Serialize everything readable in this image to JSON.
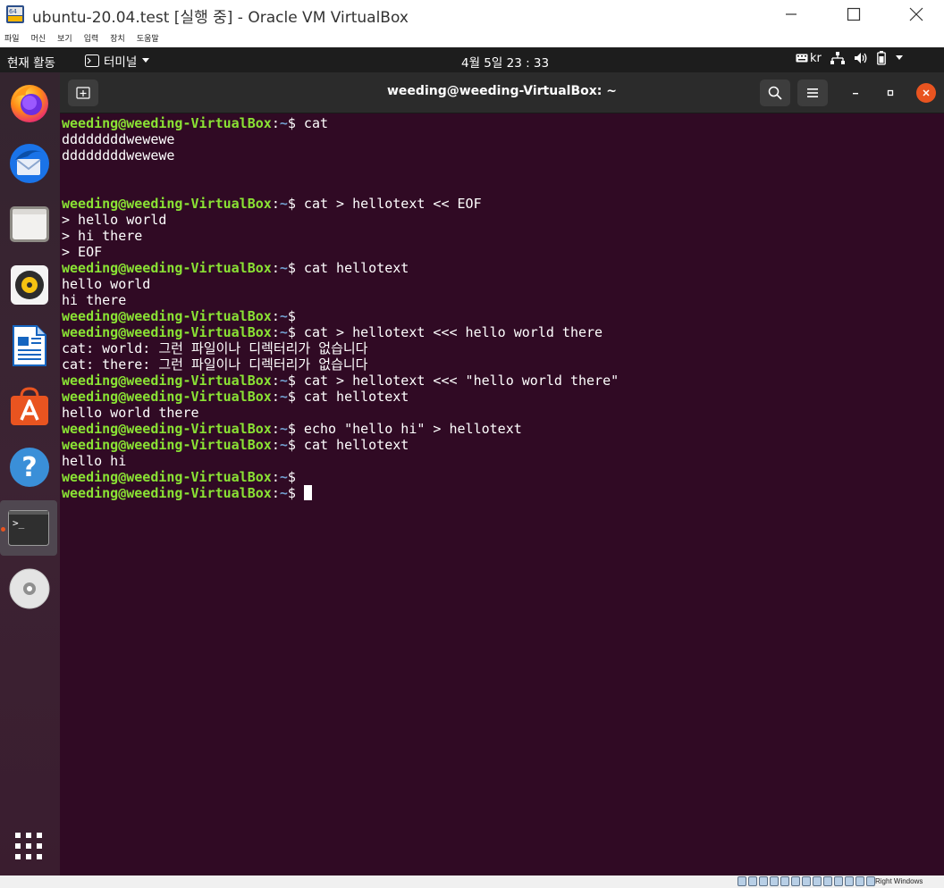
{
  "vbox": {
    "title": "ubuntu-20.04.test [실행 중] - Oracle VM VirtualBox",
    "menu": [
      "파일",
      "머신",
      "보기",
      "입력",
      "장치",
      "도움말"
    ],
    "host_key": "Right Windows"
  },
  "topbar": {
    "activities": "현재 활동",
    "app_menu": "터미널",
    "clock": "4월 5일  23 : 33",
    "keyboard": "kr"
  },
  "dock": {
    "items": [
      "firefox-icon",
      "thunderbird-icon",
      "files-icon",
      "rhythmbox-icon",
      "writer-icon",
      "software-icon",
      "help-icon",
      "terminal-icon",
      "dvd-icon"
    ]
  },
  "terminal": {
    "title": "weeding@weeding-VirtualBox: ~",
    "prompt": {
      "user": "weeding@weeding-VirtualBox",
      "sep": ":",
      "path": "~",
      "symbol": "$"
    },
    "lines": [
      {
        "cmd": " cat"
      },
      {
        "out": "ddddddddwewewe"
      },
      {
        "out": "ddddddddwewewe"
      },
      {
        "out": ""
      },
      {
        "out": ""
      },
      {
        "cmd": " cat > hellotext << EOF"
      },
      {
        "out": "> hello world"
      },
      {
        "out": "> hi there"
      },
      {
        "out": "> EOF"
      },
      {
        "cmd": " cat hellotext"
      },
      {
        "out": "hello world"
      },
      {
        "out": "hi there"
      },
      {
        "cmd": ""
      },
      {
        "cmd": " cat > hellotext <<< hello world there"
      },
      {
        "out": "cat: world: 그런 파일이나 디렉터리가 없습니다"
      },
      {
        "out": "cat: there: 그런 파일이나 디렉터리가 없습니다"
      },
      {
        "cmd": " cat > hellotext <<< \"hello world there\""
      },
      {
        "cmd": " cat hellotext"
      },
      {
        "out": "hello world there"
      },
      {
        "cmd": " echo \"hello hi\" > hellotext"
      },
      {
        "cmd": " cat hellotext"
      },
      {
        "out": "hello hi"
      },
      {
        "cmd": ""
      },
      {
        "cmd": " ",
        "cursor": true
      }
    ]
  },
  "colors": {
    "terminal_bg": "#300a24",
    "prompt_user": "#8ae234",
    "prompt_path": "#729fcf",
    "accent": "#e95420"
  }
}
